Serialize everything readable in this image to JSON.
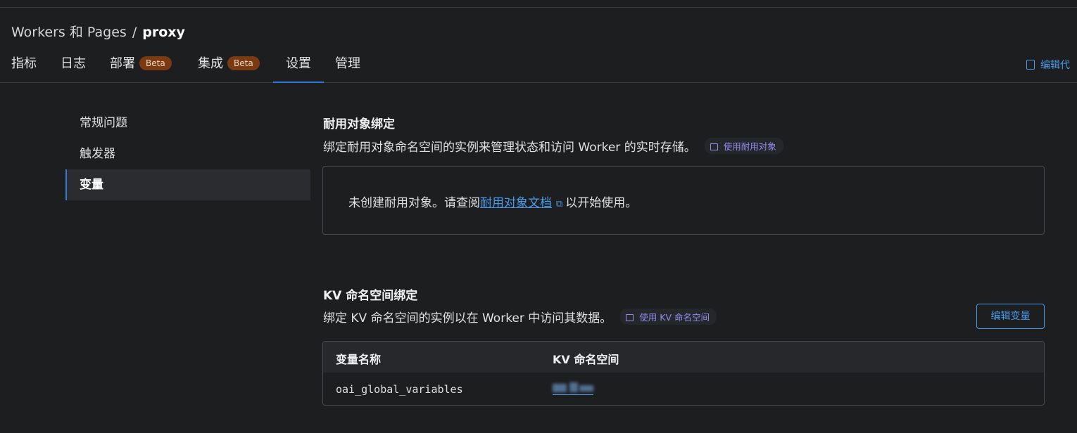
{
  "breadcrumb": {
    "parent": "Workers 和 Pages",
    "separator": "/",
    "current": "proxy"
  },
  "tabs": [
    {
      "label": "指标"
    },
    {
      "label": "日志"
    },
    {
      "label": "部署",
      "badge": "Beta"
    },
    {
      "label": "集成",
      "badge": "Beta"
    },
    {
      "label": "设置",
      "active": true
    },
    {
      "label": "管理"
    }
  ],
  "header": {
    "edit_code_label": "编辑代"
  },
  "sidenav": {
    "items": [
      {
        "label": "常规问题"
      },
      {
        "label": "触发器"
      },
      {
        "label": "变量",
        "active": true
      }
    ]
  },
  "durable_objects": {
    "title": "耐用对象绑定",
    "description": "绑定耐用对象命名空间的实例来管理状态和访问 Worker 的实时存储。",
    "pill_label": "使用耐用对象",
    "empty_prefix": "未创建耐用对象。请查阅",
    "empty_link": "耐用对象文档",
    "empty_suffix": "以开始使用。"
  },
  "kv": {
    "title": "KV 命名空间绑定",
    "description": "绑定 KV 命名空间的实例以在 Worker 中访问其数据。",
    "pill_label": "使用 KV 命名空间",
    "edit_button": "编辑变量",
    "columns": [
      "变量名称",
      "KV 命名空间"
    ],
    "rows": [
      {
        "name": "oai_global_variables",
        "namespace": ""
      }
    ]
  },
  "colors": {
    "background": "#1d1e20",
    "accent": "#2f7bd8",
    "link": "#4b9be8",
    "beta_badge": "#7a3a12",
    "pill_text": "#8f8ff0"
  },
  "icons": [
    "book-icon",
    "external-link-icon",
    "code-file-icon"
  ]
}
